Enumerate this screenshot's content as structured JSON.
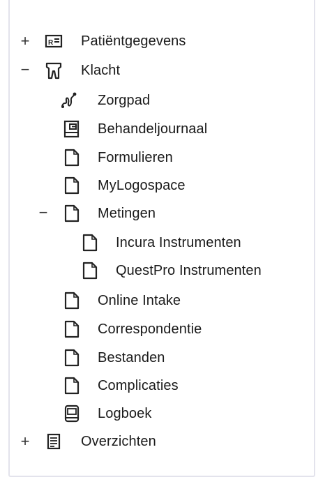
{
  "tree": {
    "items": [
      {
        "label": "Patiëntgegevens",
        "toggle": "+",
        "icon": "id-card-icon"
      },
      {
        "label": "Klacht",
        "toggle": "−",
        "icon": "tooth-icon"
      },
      {
        "label": "Zorgpad",
        "toggle": "",
        "icon": "path-icon"
      },
      {
        "label": "Behandeljournaal",
        "toggle": "",
        "icon": "journal-icon"
      },
      {
        "label": "Formulieren",
        "toggle": "",
        "icon": "document-icon"
      },
      {
        "label": "MyLogospace",
        "toggle": "",
        "icon": "document-icon"
      },
      {
        "label": "Metingen",
        "toggle": "−",
        "icon": "document-icon"
      },
      {
        "label": "Incura Instrumenten",
        "toggle": "",
        "icon": "document-icon"
      },
      {
        "label": "QuestPro Instrumenten",
        "toggle": "",
        "icon": "document-icon"
      },
      {
        "label": "Online Intake",
        "toggle": "",
        "icon": "document-icon"
      },
      {
        "label": "Correspondentie",
        "toggle": "",
        "icon": "document-icon"
      },
      {
        "label": "Bestanden",
        "toggle": "",
        "icon": "document-icon"
      },
      {
        "label": "Complicaties",
        "toggle": "",
        "icon": "document-icon"
      },
      {
        "label": "Logboek",
        "toggle": "",
        "icon": "logbook-icon"
      },
      {
        "label": "Overzichten",
        "toggle": "+",
        "icon": "list-icon"
      }
    ]
  }
}
